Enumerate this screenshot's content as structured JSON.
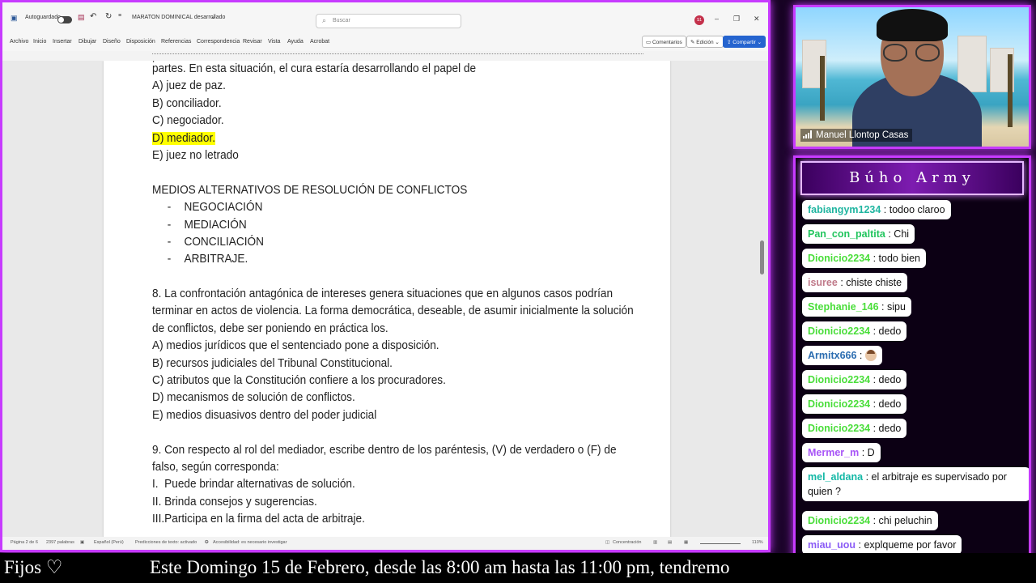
{
  "word": {
    "autosave_label": "Autoguardado",
    "doc_title": "MARATON DOMINICAL desarrollado",
    "search_placeholder": "Buscar",
    "user_initials": "S1",
    "menu": [
      "Archivo",
      "Inicio",
      "Insertar",
      "Dibujar",
      "Diseño",
      "Disposición",
      "Referencias",
      "Correspondencia",
      "Revisar",
      "Vista",
      "Ayuda",
      "Acrobat"
    ],
    "comments_label": "Comentarios",
    "editing_label": "Edición",
    "share_label": "Compartir",
    "status": {
      "page": "Página 2 de 6",
      "words": "2397 palabras",
      "language": "Español (Perú)",
      "predictions": "Predicciones de texto: activado",
      "accessibility": "Accesibilidad: es necesario investigar",
      "focus": "Concentración",
      "zoom": "110%"
    }
  },
  "document": {
    "line_partes": "partes. En esta situación, el cura estaría desarrollando el papel de",
    "q7_options": [
      "A) juez de paz.",
      "B) conciliador.",
      "C) negociador.",
      "D) mediador.",
      "E) juez no letrado"
    ],
    "section_title": "MEDIOS ALTERNATIVOS DE RESOLUCIÓN DE CONFLICTOS",
    "section_items": [
      "NEGOCIACIÓN",
      "MEDIACIÓN",
      "CONCILIACIÓN",
      "ARBITRAJE."
    ],
    "q8_lines": [
      "8. La confrontación antagónica de intereses genera situaciones que en algunos casos podrían",
      "terminar en actos de violencia. La forma democrática, deseable, de asumir inicialmente la solución",
      "de conflictos, debe ser poniendo en práctica los."
    ],
    "q8_options": [
      "A) medios jurídicos que el sentenciado pone a disposición.",
      "B) recursos judiciales del Tribunal Constitucional.",
      "C) atributos que la Constitución confiere a los procuradores.",
      "D) mecanismos de solución de conflictos.",
      "E) medios disuasivos dentro del poder judicial"
    ],
    "q9_lines": [
      "9. Con respecto al rol del mediador, escribe dentro de los paréntesis, (V) de verdadero o (F) de",
      "falso, según corresponda:"
    ],
    "q9_items": [
      "I.  Puede brindar alternativas de solución.",
      "II. Brinda consejos y sugerencias.",
      "III.Participa en la firma del acta de arbitraje."
    ]
  },
  "webcam": {
    "name": "Manuel Llontop Casas"
  },
  "chat": {
    "title": "Búho Army",
    "messages": [
      {
        "user": "fabiangym1234",
        "text": "todoo claroo",
        "color": "#1fb5a0"
      },
      {
        "user": "Pan_con_paltita",
        "text": "Chi",
        "color": "#22c55e"
      },
      {
        "user": "Dionicio2234",
        "text": "todo bien",
        "color": "#4ade3a"
      },
      {
        "user": "isuree",
        "text": "chiste chiste",
        "color": "#c07a8a"
      },
      {
        "user": "Stephanie_146",
        "text": "sipu",
        "color": "#4ade3a"
      },
      {
        "user": "Dionicio2234",
        "text": "dedo",
        "color": "#4ade3a"
      },
      {
        "user": "Armitx666",
        "text": "",
        "color": "#2b6cb0",
        "emoji": "face-emoji"
      },
      {
        "user": "Dionicio2234",
        "text": "dedo",
        "color": "#4ade3a"
      },
      {
        "user": "Dionicio2234",
        "text": "dedo",
        "color": "#4ade3a"
      },
      {
        "user": "Dionicio2234",
        "text": "dedo",
        "color": "#4ade3a"
      },
      {
        "user": "Mermer_m",
        "text": "D",
        "color": "#a855f7"
      },
      {
        "user": "mel_aldana",
        "text": "el arbitraje es supervisado por quien ?",
        "color": "#14b8a6"
      },
      {
        "user": "Dionicio2234",
        "text": "chi peluchin",
        "color": "#4ade3a"
      },
      {
        "user": "miau_uou",
        "text": "explqueme por favor",
        "color": "#8b5cf6"
      }
    ]
  },
  "bottom": {
    "pinned_label": "Fijos ♡",
    "ticker_text": "Este Domingo 15 de Febrero, desde las 8:00 am hasta las 11:00 pm, tendremo"
  },
  "colors": {
    "accent_border": "#c73bff",
    "highlight": "#ffff00",
    "share_button": "#2564cf"
  }
}
